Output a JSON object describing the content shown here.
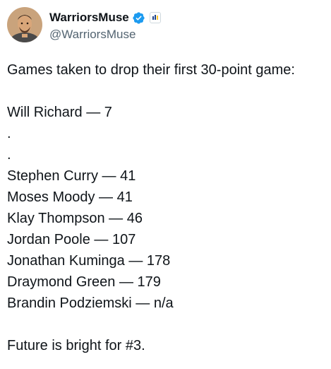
{
  "user": {
    "display_name": "WarriorsMuse",
    "handle": "@WarriorsMuse",
    "verified_color": "#1d9bf0"
  },
  "tweet": {
    "intro": "Games taken to drop their first 30-point game:",
    "first_entry": "Will Richard — 7",
    "dots": [
      ".",
      "."
    ],
    "entries": [
      "Stephen Curry — 41",
      "Moses Moody — 41",
      "Klay Thompson — 46",
      "Jordan Poole — 107",
      "Jonathan Kuminga — 178",
      "Draymond Green — 179",
      "Brandin Podziemski — n/a"
    ],
    "closing": "Future is bright for #3."
  }
}
